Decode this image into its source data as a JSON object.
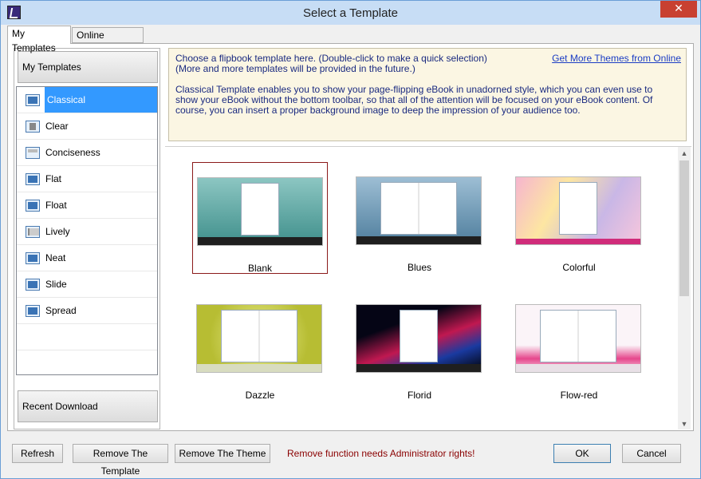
{
  "window": {
    "title": "Select a Template",
    "close_glyph": "✕"
  },
  "tabs": [
    "My Templates",
    "Online Templates"
  ],
  "left": {
    "group_label": "My Templates",
    "items": [
      {
        "label": "Classical",
        "icon": "classical-icon"
      },
      {
        "label": "Clear",
        "icon": "clear-icon"
      },
      {
        "label": "Conciseness",
        "icon": "conciseness-icon"
      },
      {
        "label": "Flat",
        "icon": "flat-icon"
      },
      {
        "label": "Float",
        "icon": "float-icon"
      },
      {
        "label": "Lively",
        "icon": "lively-icon"
      },
      {
        "label": "Neat",
        "icon": "neat-icon"
      },
      {
        "label": "Slide",
        "icon": "slide-icon"
      },
      {
        "label": "Spread",
        "icon": "spread-icon"
      }
    ],
    "selected": "Classical",
    "recent_label": "Recent Download"
  },
  "info": {
    "line1": "Choose a flipbook template here. (Double-click to make a quick selection)",
    "line2": "(More and more templates will be provided in the future.)",
    "description": "Classical Template enables you to show your page-flipping eBook in unadorned style, which you can even use to show your eBook without the bottom toolbar, so that all of the attention will be focused on your eBook content. Of course, you can insert a proper background image to deep the impression of your audience too.",
    "link": "Get More Themes from Online"
  },
  "themes": [
    {
      "name": "Blank",
      "selected": true,
      "bg": "#5fa8a4"
    },
    {
      "name": "Blues",
      "bg": "#6b97b5"
    },
    {
      "name": "Colorful",
      "bg": "#f2c7d8"
    },
    {
      "name": "Dazzle",
      "bg": "#c9cf4b"
    },
    {
      "name": "Florid",
      "bg": "#0a0a2a"
    },
    {
      "name": "Flow-red",
      "bg": "#f4e8f0"
    }
  ],
  "buttons": {
    "refresh": "Refresh",
    "remove_template": "Remove The Template",
    "remove_theme": "Remove The Theme",
    "ok": "OK",
    "cancel": "Cancel"
  },
  "warning": "Remove function needs Administrator rights!"
}
